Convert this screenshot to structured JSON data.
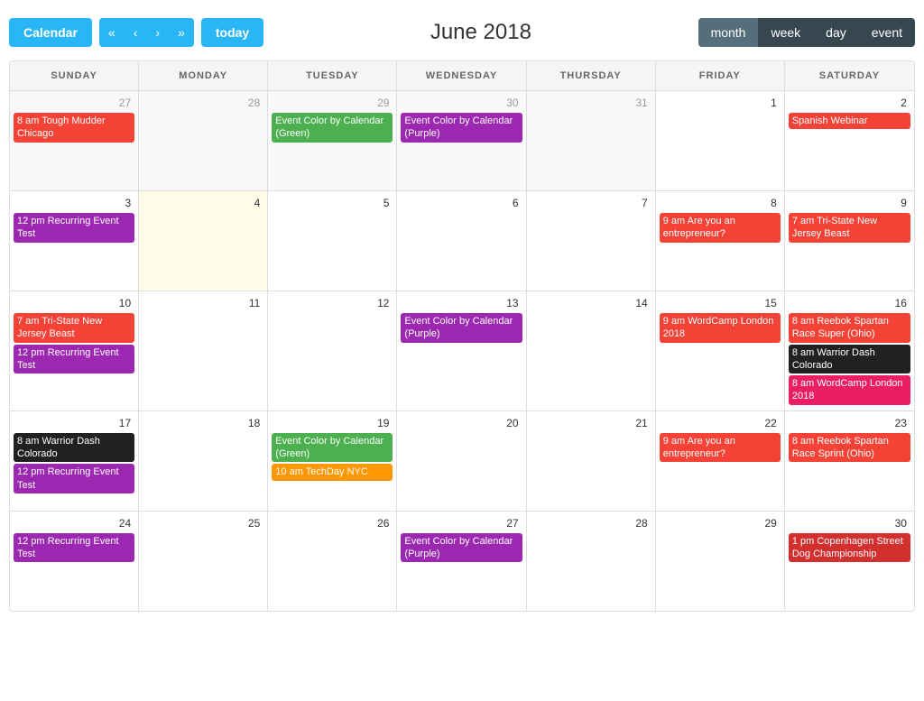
{
  "header": {
    "title": "June 2018",
    "calendar_btn": "Calendar",
    "today_btn": "today",
    "nav_btns": [
      "«",
      "‹",
      "›",
      "»"
    ],
    "view_btns": [
      "month",
      "week",
      "day",
      "event"
    ],
    "active_view": "month"
  },
  "day_headers": [
    "SUNDAY",
    "MONDAY",
    "TUESDAY",
    "WEDNESDAY",
    "THURSDAY",
    "FRIDAY",
    "SATURDAY"
  ],
  "weeks": [
    {
      "days": [
        {
          "num": "27",
          "is_other": true,
          "events": [
            {
              "label": "8 am Tough Mudder Chicago",
              "color": "orange"
            }
          ]
        },
        {
          "num": "28",
          "is_other": true,
          "events": []
        },
        {
          "num": "29",
          "is_other": true,
          "events": [
            {
              "label": "Event Color by Calendar (Green)",
              "color": "green",
              "span": true
            }
          ]
        },
        {
          "num": "30",
          "is_other": true,
          "events": [
            {
              "label": "Event Color by Calendar (Purple)",
              "color": "purple",
              "span": true
            }
          ]
        },
        {
          "num": "31",
          "is_other": true,
          "events": []
        },
        {
          "num": "1",
          "events": []
        },
        {
          "num": "2",
          "events": [
            {
              "label": "Spanish Webinar",
              "color": "red"
            }
          ]
        }
      ]
    },
    {
      "days": [
        {
          "num": "3",
          "events": [
            {
              "label": "12 pm Recurring Event Test",
              "color": "purple"
            }
          ]
        },
        {
          "num": "4",
          "is_today": true,
          "events": []
        },
        {
          "num": "5",
          "events": []
        },
        {
          "num": "6",
          "events": []
        },
        {
          "num": "7",
          "events": []
        },
        {
          "num": "8",
          "events": [
            {
              "label": "9 am Are you an entrepreneur?",
              "color": "orange"
            }
          ]
        },
        {
          "num": "9",
          "events": [
            {
              "label": "7 am Tri-State New Jersey Beast",
              "color": "red"
            }
          ]
        }
      ]
    },
    {
      "days": [
        {
          "num": "10",
          "events": [
            {
              "label": "7 am Tri-State New Jersey Beast",
              "color": "red"
            },
            {
              "label": "12 pm Recurring Event Test",
              "color": "purple"
            }
          ]
        },
        {
          "num": "11",
          "events": []
        },
        {
          "num": "12",
          "events": []
        },
        {
          "num": "13",
          "events": [
            {
              "label": "Event Color by Calendar (Purple)",
              "color": "purple",
              "span": true
            }
          ]
        },
        {
          "num": "14",
          "events": []
        },
        {
          "num": "15",
          "events": [
            {
              "label": "9 am WordCamp London 2018",
              "color": "orange"
            }
          ]
        },
        {
          "num": "16",
          "events": [
            {
              "label": "8 am Reebok Spartan Race Super (Ohio)",
              "color": "red"
            },
            {
              "label": "8 am Warrior Dash Colorado",
              "color": "black"
            },
            {
              "label": "8 am WordCamp London 2018",
              "color": "pink"
            }
          ]
        }
      ]
    },
    {
      "days": [
        {
          "num": "17",
          "events": [
            {
              "label": "8 am Warrior Dash Colorado",
              "color": "black"
            },
            {
              "label": "12 pm Recurring Event Test",
              "color": "purple"
            }
          ]
        },
        {
          "num": "18",
          "events": []
        },
        {
          "num": "19",
          "events": [
            {
              "label": "Event Color by Calendar (Green)",
              "color": "green",
              "span": true
            },
            {
              "label": "10 am TechDay NYC",
              "color": "amber"
            }
          ]
        },
        {
          "num": "20",
          "events": []
        },
        {
          "num": "21",
          "events": []
        },
        {
          "num": "22",
          "events": [
            {
              "label": "9 am Are you an entrepreneur?",
              "color": "orange"
            }
          ]
        },
        {
          "num": "23",
          "events": [
            {
              "label": "8 am Reebok Spartan Race Sprint (Ohio)",
              "color": "red"
            }
          ]
        }
      ]
    },
    {
      "days": [
        {
          "num": "24",
          "events": [
            {
              "label": "12 pm Recurring Event Test",
              "color": "purple"
            }
          ]
        },
        {
          "num": "25",
          "events": []
        },
        {
          "num": "26",
          "events": []
        },
        {
          "num": "27",
          "events": [
            {
              "label": "Event Color by Calendar (Purple)",
              "color": "purple",
              "span": true
            }
          ]
        },
        {
          "num": "28",
          "events": []
        },
        {
          "num": "29",
          "events": []
        },
        {
          "num": "30",
          "events": [
            {
              "label": "1 pm Copenhagen Street Dog Championship",
              "color": "dark-red"
            }
          ]
        }
      ]
    }
  ]
}
